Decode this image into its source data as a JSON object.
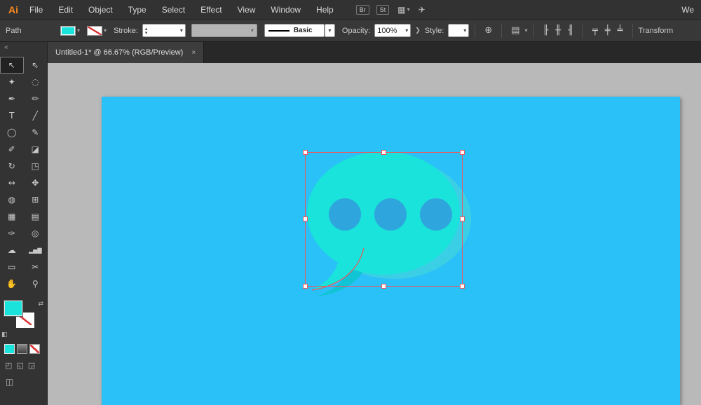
{
  "app": {
    "logo": "Ai"
  },
  "glyphs": {
    "chevron": "▾",
    "spinner_up": "▴",
    "spinner_down": "▾",
    "panel_arrow": "❯",
    "globe": "⊕",
    "docsetup": "▤",
    "share": "✈",
    "arrange": "▦",
    "collapse": "«",
    "close": "×",
    "swap": "⇄",
    "default_swatches": "◧",
    "screen_mode": "◫"
  },
  "menubar": {
    "items": [
      "File",
      "Edit",
      "Object",
      "Type",
      "Select",
      "Effect",
      "View",
      "Window",
      "Help"
    ],
    "br_label": "Br",
    "st_label": "St",
    "workspace_partial": "We"
  },
  "controlbar": {
    "path_label": "Path",
    "stroke_label": "Stroke:",
    "line_style_value": "Basic",
    "opacity_label": "Opacity:",
    "opacity_value": "100%",
    "style_label": "Style:",
    "align_icons": [
      "╟",
      "╫",
      "╢",
      "╤",
      "╪",
      "╧"
    ],
    "transform_label": "Transform"
  },
  "tabbar": {
    "tab_title": "Untitled-1* @ 66.67% (RGB/Preview)"
  },
  "toolbar": {
    "tools": [
      {
        "name": "selection",
        "glyph": "↖",
        "selected": true
      },
      {
        "name": "direct-selection",
        "glyph": "⇖"
      },
      {
        "name": "magic-wand",
        "glyph": "✦"
      },
      {
        "name": "lasso",
        "glyph": "◌"
      },
      {
        "name": "pen",
        "glyph": "✒"
      },
      {
        "name": "curvature",
        "glyph": "✏"
      },
      {
        "name": "type",
        "glyph": "T"
      },
      {
        "name": "line-segment",
        "glyph": "╱"
      },
      {
        "name": "ellipse",
        "glyph": "◯"
      },
      {
        "name": "paintbrush",
        "glyph": "✎"
      },
      {
        "name": "pencil",
        "glyph": "✐"
      },
      {
        "name": "eraser",
        "glyph": "◪"
      },
      {
        "name": "rotate",
        "glyph": "↻"
      },
      {
        "name": "scale",
        "glyph": "◳"
      },
      {
        "name": "width-tool",
        "glyph": "↔"
      },
      {
        "name": "free-transform",
        "glyph": "✥"
      },
      {
        "name": "shape-builder",
        "glyph": "◍"
      },
      {
        "name": "perspective-grid",
        "glyph": "⊞"
      },
      {
        "name": "mesh",
        "glyph": "▦"
      },
      {
        "name": "gradient",
        "glyph": "▤"
      },
      {
        "name": "eyedropper",
        "glyph": "✑"
      },
      {
        "name": "blend",
        "glyph": "◎"
      },
      {
        "name": "symbol-sprayer",
        "glyph": "☁"
      },
      {
        "name": "column-graph",
        "glyph": "▂▅▇"
      },
      {
        "name": "artboard-tool",
        "glyph": "▭"
      },
      {
        "name": "slice",
        "glyph": "✂"
      },
      {
        "name": "hand",
        "glyph": "✋"
      },
      {
        "name": "zoom",
        "glyph": "⚲"
      }
    ]
  },
  "artwork": {
    "dot_count": 3
  },
  "colors": {
    "artboard": "#29c1f7",
    "bubble": "#19e3da",
    "bubble_back": "#3bcfe6",
    "tail_shadow": "#10c4d4",
    "dot": "#2ea5dc",
    "selection": "#f0565b",
    "fill_swatch": "#19e3da",
    "none_slash": "#dd3a3a"
  }
}
